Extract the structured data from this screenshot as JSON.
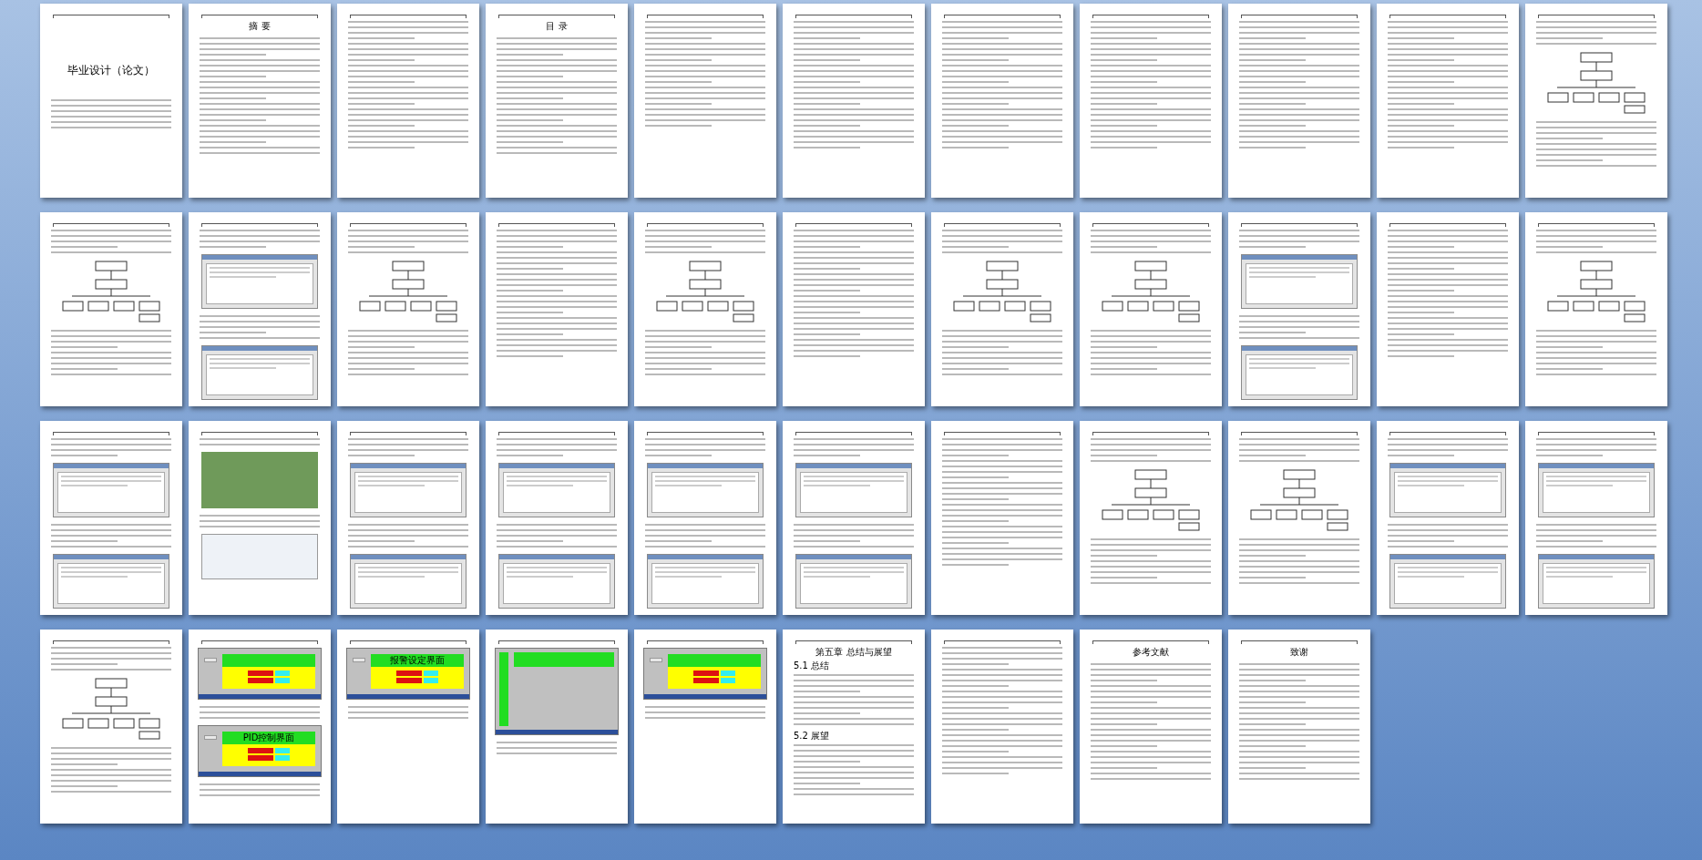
{
  "pages": [
    {
      "kind": "cover",
      "title": "毕业设计（论文）"
    },
    {
      "kind": "text",
      "title": "摘 要"
    },
    {
      "kind": "text"
    },
    {
      "kind": "toc",
      "title": "目 录"
    },
    {
      "kind": "toc"
    },
    {
      "kind": "text"
    },
    {
      "kind": "text"
    },
    {
      "kind": "text"
    },
    {
      "kind": "text"
    },
    {
      "kind": "text"
    },
    {
      "kind": "diagram"
    },
    {
      "kind": "diagram"
    },
    {
      "kind": "screen"
    },
    {
      "kind": "diagram"
    },
    {
      "kind": "text"
    },
    {
      "kind": "diagram"
    },
    {
      "kind": "text"
    },
    {
      "kind": "diagram"
    },
    {
      "kind": "diagram"
    },
    {
      "kind": "screen"
    },
    {
      "kind": "text"
    },
    {
      "kind": "diagram"
    },
    {
      "kind": "screen"
    },
    {
      "kind": "photo"
    },
    {
      "kind": "screen"
    },
    {
      "kind": "screen"
    },
    {
      "kind": "screen"
    },
    {
      "kind": "screen"
    },
    {
      "kind": "text"
    },
    {
      "kind": "diagram"
    },
    {
      "kind": "diagram"
    },
    {
      "kind": "screen"
    },
    {
      "kind": "screen"
    },
    {
      "kind": "diagram"
    },
    {
      "kind": "hmi",
      "screens": [
        {
          "kind": "panel"
        },
        {
          "kind": "panel",
          "title": "PID控制界面"
        }
      ]
    },
    {
      "kind": "hmi",
      "screens": [
        {
          "kind": "panel",
          "title": "报警设定界面"
        }
      ]
    },
    {
      "kind": "hmi",
      "screens": [
        {
          "kind": "bar"
        }
      ]
    },
    {
      "kind": "hmi",
      "screens": [
        {
          "kind": "panel"
        }
      ]
    },
    {
      "kind": "text",
      "title": "第五章 总结与展望",
      "headings": [
        "5.1 总结",
        "5.2 展望"
      ]
    },
    {
      "kind": "text"
    },
    {
      "kind": "text",
      "title": "参考文献"
    },
    {
      "kind": "text",
      "title": "致谢"
    }
  ]
}
